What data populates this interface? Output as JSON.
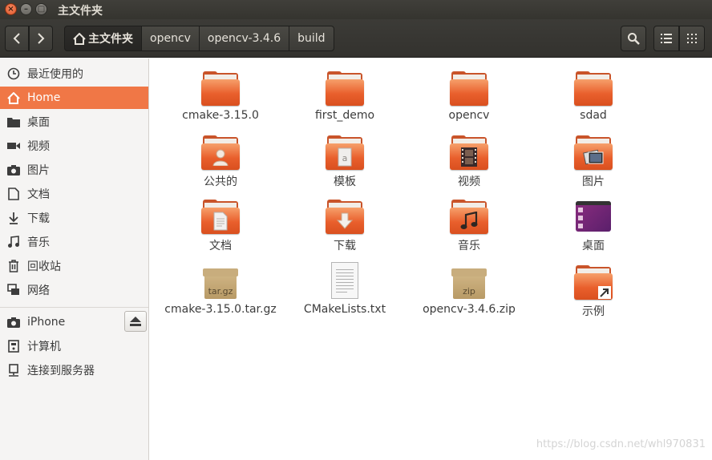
{
  "window": {
    "title": "主文件夹",
    "close_glyph": "×",
    "min_glyph": "–",
    "max_glyph": "□"
  },
  "toolbar": {
    "breadcrumbs": [
      {
        "label": "主文件夹",
        "active": true,
        "icon": "home-icon"
      },
      {
        "label": "opencv"
      },
      {
        "label": "opencv-3.4.6"
      },
      {
        "label": "build"
      }
    ]
  },
  "sidebar": {
    "items": [
      {
        "label": "最近使用的",
        "icon": "clock-icon"
      },
      {
        "label": "Home",
        "icon": "home-icon",
        "active": true
      },
      {
        "label": "桌面",
        "icon": "folder-icon"
      },
      {
        "label": "视频",
        "icon": "video-icon"
      },
      {
        "label": "图片",
        "icon": "camera-icon"
      },
      {
        "label": "文档",
        "icon": "document-icon"
      },
      {
        "label": "下载",
        "icon": "download-icon"
      },
      {
        "label": "音乐",
        "icon": "music-icon"
      },
      {
        "label": "回收站",
        "icon": "trash-icon"
      },
      {
        "label": "网络",
        "icon": "network-icon"
      }
    ],
    "devices": [
      {
        "label": "iPhone",
        "icon": "camera-icon"
      },
      {
        "label": "计算机",
        "icon": "computer-icon"
      },
      {
        "label": "连接到服务器",
        "icon": "server-icon"
      }
    ]
  },
  "files": [
    {
      "label": "cmake-3.15.0",
      "type": "folder"
    },
    {
      "label": "first_demo",
      "type": "folder"
    },
    {
      "label": "opencv",
      "type": "folder"
    },
    {
      "label": "sdad",
      "type": "folder"
    },
    {
      "label": "公共的",
      "type": "folder",
      "emblem": "person-icon"
    },
    {
      "label": "模板",
      "type": "folder",
      "emblem": "template-icon"
    },
    {
      "label": "视频",
      "type": "folder",
      "emblem": "film-icon"
    },
    {
      "label": "图片",
      "type": "folder",
      "emblem": "picture-icon"
    },
    {
      "label": "文档",
      "type": "folder",
      "emblem": "document-icon"
    },
    {
      "label": "下载",
      "type": "folder",
      "emblem": "download-arrow-icon"
    },
    {
      "label": "音乐",
      "type": "folder",
      "emblem": "music-note-icon"
    },
    {
      "label": "桌面",
      "type": "desktop"
    },
    {
      "label": "cmake-3.15.0.tar.gz",
      "type": "archive",
      "ext": "tar.gz"
    },
    {
      "label": "CMakeLists.txt",
      "type": "text"
    },
    {
      "label": "opencv-3.4.6.zip",
      "type": "archive",
      "ext": "zip"
    },
    {
      "label": "示例",
      "type": "folder",
      "emblem": "link-arrow-icon"
    }
  ],
  "watermark": "https://blog.csdn.net/whl970831"
}
